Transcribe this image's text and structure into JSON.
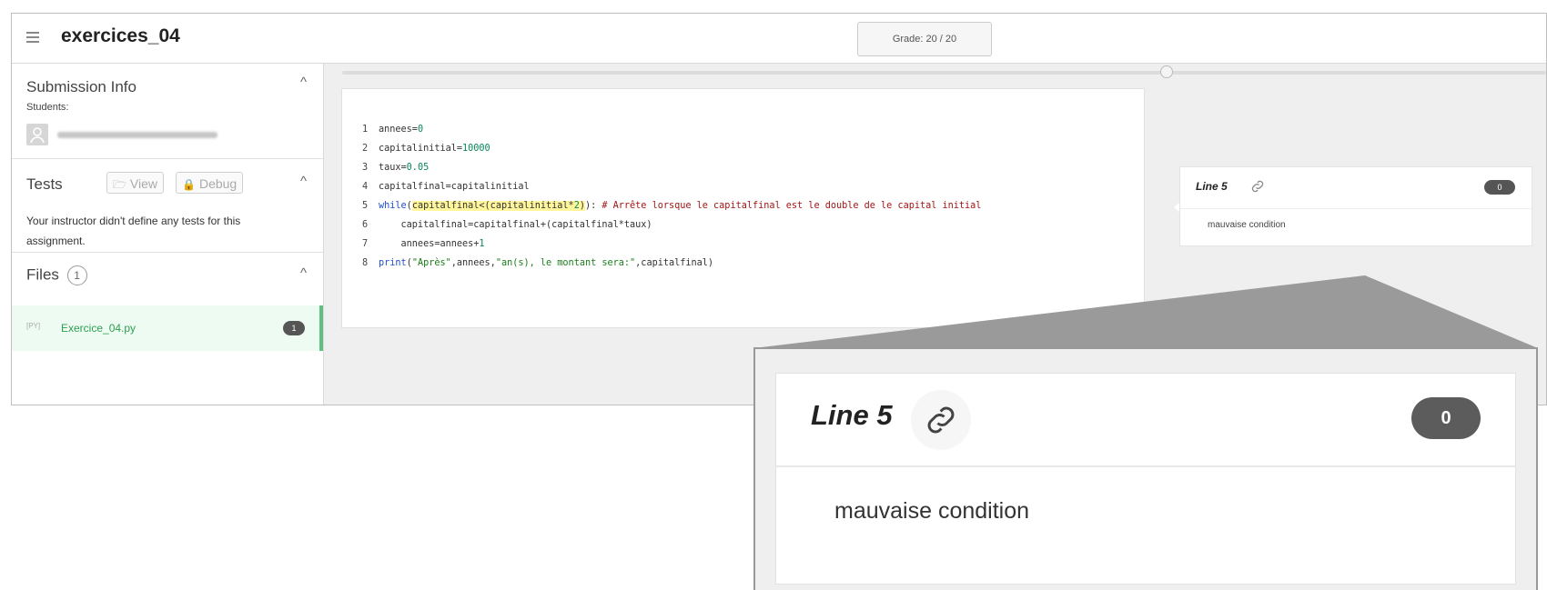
{
  "header": {
    "title": "exercices_04",
    "grade": "Grade: 20 / 20"
  },
  "sidebar": {
    "submission": {
      "title": "Submission Info",
      "students_label": "Students:"
    },
    "tests": {
      "title": "Tests",
      "view_label": "View",
      "debug_label": "Debug",
      "message": "Your instructor didn't define any tests for this assignment."
    },
    "files": {
      "title": "Files",
      "count": "1",
      "items": [
        {
          "tag": "[PY]",
          "name": "Exercice_04.py",
          "badge": "1"
        }
      ]
    }
  },
  "code": {
    "lines": [
      {
        "no": "1",
        "text": "annees=0"
      },
      {
        "no": "2",
        "text": "capitalinitial=10000"
      },
      {
        "no": "3",
        "text": "taux=0.05"
      },
      {
        "no": "4",
        "text": "capitalfinal=capitalinitial"
      },
      {
        "no": "5",
        "text": "while(capitalfinal<(capitalinitial*2)): # Arrête lorsque le capitalfinal est le double de le capital initial"
      },
      {
        "no": "6",
        "text": "    capitalfinal=capitalfinal+(capitalfinal*taux)"
      },
      {
        "no": "7",
        "text": "    annees=annees+1"
      },
      {
        "no": "8",
        "text": "print(\"Après\",annees,\"an(s), le montant sera:\",capitalfinal)"
      }
    ]
  },
  "comment": {
    "line_label": "Line 5",
    "badge": "0",
    "text": "mauvaise condition"
  },
  "icons": {
    "menu": "hamburger-icon",
    "collapse": "chevron-up-icon",
    "link": "link-icon",
    "folder": "folder-open-icon",
    "debug": "lock-icon",
    "avatar": "user-icon"
  },
  "colors": {
    "accent_green": "#5cc17e",
    "file_text": "#2e9e4f",
    "badge": "#555555",
    "highlight": "#fff59a"
  }
}
